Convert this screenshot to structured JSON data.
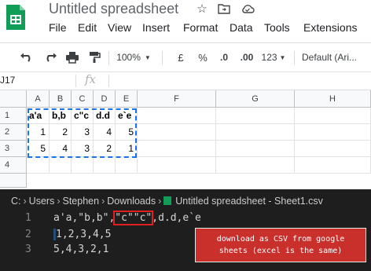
{
  "header": {
    "title": "Untitled spreadsheet",
    "menu": [
      "File",
      "Edit",
      "View",
      "Insert",
      "Format",
      "Data",
      "Tools",
      "Extensions"
    ]
  },
  "toolbar": {
    "zoom": "100%",
    "currency": "£",
    "percent": "%",
    "decrease_decimals": ".0",
    "increase_decimals": ".00",
    "more_formats": "123",
    "font": "Default (Ari..."
  },
  "formula_bar": {
    "cell_ref": "J17",
    "fx": "fx"
  },
  "grid": {
    "columns": [
      "A",
      "B",
      "C",
      "D",
      "E",
      "F",
      "G",
      "H"
    ],
    "rows": [
      "1",
      "2",
      "3",
      "4"
    ],
    "cells": [
      [
        "a'a",
        "b,b",
        "c\"c",
        "d.d",
        "e`e"
      ],
      [
        "1",
        "2",
        "3",
        "4",
        "5"
      ],
      [
        "5",
        "4",
        "3",
        "2",
        "1"
      ]
    ]
  },
  "editor": {
    "breadcrumb": [
      "C:",
      "Users",
      "Stephen",
      "Downloads",
      "Untitled spreadsheet - Sheet1.csv"
    ],
    "line_numbers": [
      "1",
      "2",
      "3"
    ],
    "line1_before": "a'a,\"b,b\",",
    "line1_highlight": "\"c\"\"c\"",
    "line1_after": ",d.d,e`e",
    "line2": "1,2,3,4,5",
    "line3": "5,4,3,2,1"
  },
  "annotation": {
    "line1": "download as CSV from google",
    "line2": "sheets (excel is the same)"
  },
  "colors": {
    "sheets_green": "#0f9d58",
    "selection_blue": "#1a73e8",
    "highlight_red": "#e02020",
    "note_red": "#c9302c",
    "editor_bg": "#1e1e1e"
  }
}
